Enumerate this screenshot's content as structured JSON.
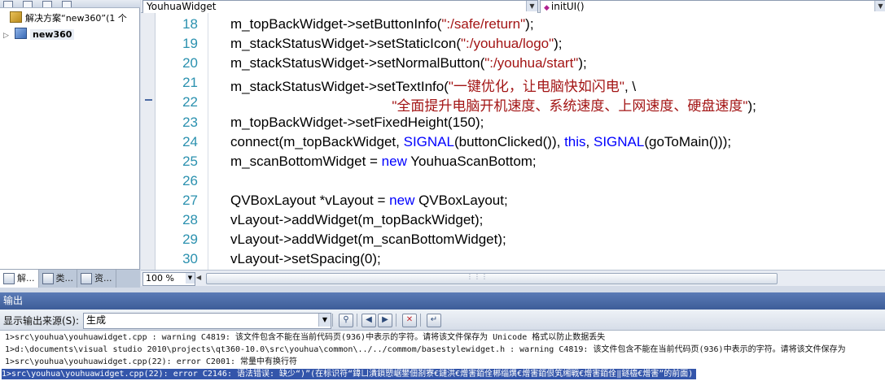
{
  "solution_explorer": {
    "root_label": "解决方案“new360”(1 个",
    "project_label": "new360",
    "tabs": [
      {
        "label": "解..."
      },
      {
        "label": "类..."
      },
      {
        "label": "资..."
      }
    ]
  },
  "editor": {
    "class_dropdown": "YouhuaWidget",
    "member_dropdown": "initUI()",
    "zoom": "100 %",
    "lines": [
      {
        "num": "18",
        "parts": [
          {
            "t": "m_topBackWidget->setButtonInfo(",
            "c": ""
          },
          {
            "t": "\":/safe/return\"",
            "c": "str"
          },
          {
            "t": ");",
            "c": ""
          }
        ]
      },
      {
        "num": "19",
        "parts": [
          {
            "t": "m_stackStatusWidget->setStaticIcon(",
            "c": ""
          },
          {
            "t": "\":/youhua/logo\"",
            "c": "str"
          },
          {
            "t": ");",
            "c": ""
          }
        ]
      },
      {
        "num": "20",
        "parts": [
          {
            "t": "m_stackStatusWidget->setNormalButton(",
            "c": ""
          },
          {
            "t": "\":/youhua/start\"",
            "c": "str"
          },
          {
            "t": ");",
            "c": ""
          }
        ]
      },
      {
        "num": "21",
        "parts": [
          {
            "t": "m_stackStatusWidget->setTextInfo(",
            "c": ""
          },
          {
            "t": "\"一键优化，让电脑快如闪电\"",
            "c": "str"
          },
          {
            "t": ", \\",
            "c": ""
          }
        ]
      },
      {
        "num": "22",
        "parts": [
          {
            "t": "                                          ",
            "c": ""
          },
          {
            "t": "\"全面提升电脑开机速度、系统速度、上网速度、硬盘速度\"",
            "c": "str"
          },
          {
            "t": ");",
            "c": ""
          }
        ]
      },
      {
        "num": "23",
        "parts": [
          {
            "t": "m_topBackWidget->setFixedHeight(150);",
            "c": ""
          }
        ]
      },
      {
        "num": "24",
        "parts": [
          {
            "t": "connect(m_topBackWidget, ",
            "c": ""
          },
          {
            "t": "SIGNAL",
            "c": "kw"
          },
          {
            "t": "(buttonClicked()), ",
            "c": ""
          },
          {
            "t": "this",
            "c": "kw"
          },
          {
            "t": ", ",
            "c": ""
          },
          {
            "t": "SIGNAL",
            "c": "kw"
          },
          {
            "t": "(goToMain()));",
            "c": ""
          }
        ]
      },
      {
        "num": "25",
        "parts": [
          {
            "t": "m_scanBottomWidget = ",
            "c": ""
          },
          {
            "t": "new",
            "c": "kw"
          },
          {
            "t": " YouhuaScanBottom;",
            "c": ""
          }
        ]
      },
      {
        "num": "26",
        "parts": []
      },
      {
        "num": "27",
        "parts": [
          {
            "t": "QVBoxLayout *vLayout = ",
            "c": ""
          },
          {
            "t": "new",
            "c": "kw"
          },
          {
            "t": " QVBoxLayout;",
            "c": ""
          }
        ]
      },
      {
        "num": "28",
        "parts": [
          {
            "t": "vLayout->addWidget(m_topBackWidget);",
            "c": ""
          }
        ]
      },
      {
        "num": "29",
        "parts": [
          {
            "t": "vLayout->addWidget(m_scanBottomWidget);",
            "c": ""
          }
        ]
      },
      {
        "num": "30",
        "parts": [
          {
            "t": "vLayout->setSpacing(0);",
            "c": ""
          }
        ]
      }
    ]
  },
  "output": {
    "title": "输出",
    "source_label": "显示输出来源(S):",
    "source_value": "生成",
    "lines": [
      "1>src\\youhua\\youhuawidget.cpp : warning C4819: 该文件包含不能在当前代码页(936)中表示的字符。请将该文件保存为 Unicode 格式以防止数据丢失",
      "1>d:\\documents\\visual studio 2010\\projects\\qt360-10.0\\src\\youhua\\common\\../../commom/basestylewidget.h : warning C4819: 该文件包含不能在当前代码页(936)中表示的字符。请将该文件保存为",
      "1>src\\youhua\\youhuawidget.cpp(22): error C2001: 常量中有换行符",
      "1>src\\youhua\\youhuawidget.cpp(22): error C2146: 语法错误: 缺少“)”(在标识符“鍏ㄩ潰鎻愬崌鐢佃剳寮€鏈洪€熷害銆佺郴缁熼€熷害銆佷笂缃戦€熷害銆佺‖鐩橀€熷害”的前面)"
    ]
  },
  "colors": {
    "string": "#a31515",
    "keyword": "#0000ff",
    "line_number": "#2b91af",
    "output_title_bg": "#3d5d99",
    "selection": "#3355aa"
  }
}
